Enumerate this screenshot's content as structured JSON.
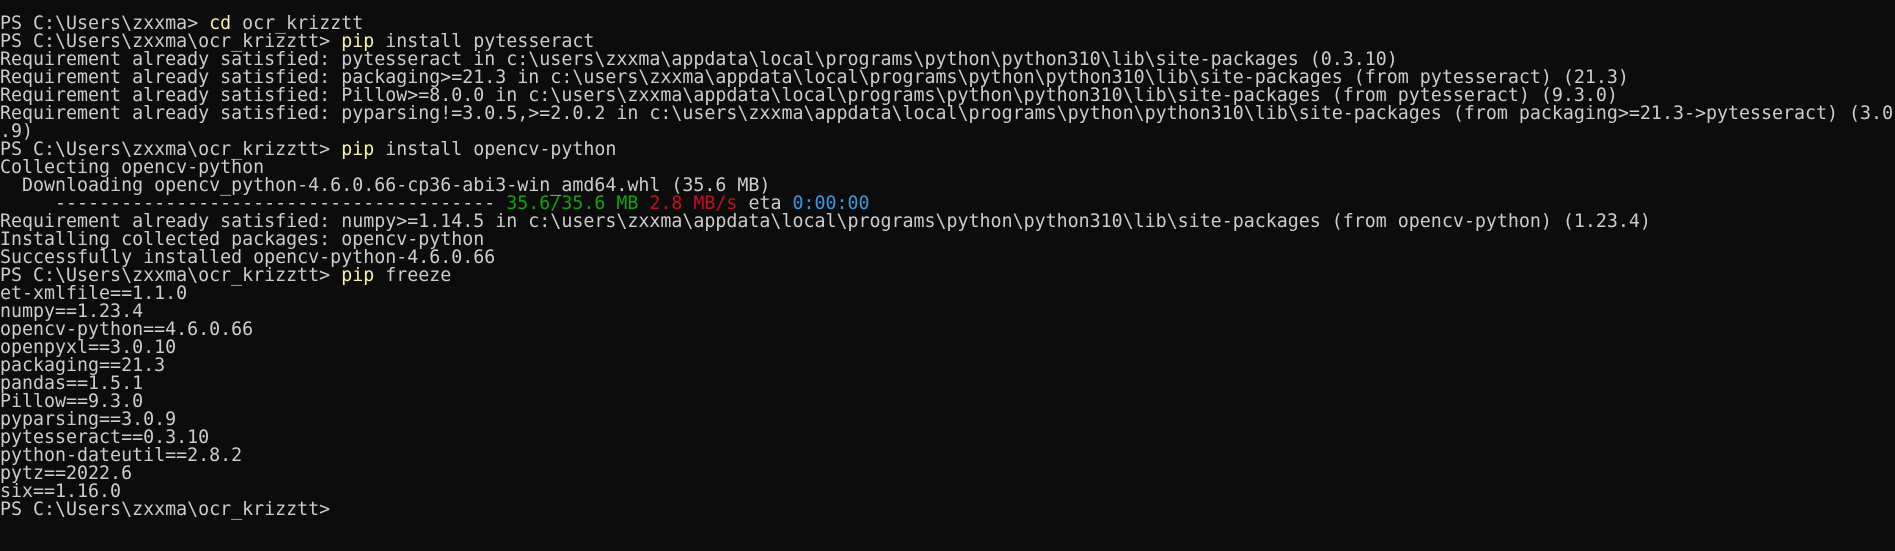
{
  "terminal": {
    "lines": [
      {
        "prompt": "PS C:\\Users\\zxxma> ",
        "cmd": "cd",
        "args": " ocr_krizztt"
      },
      {
        "prompt": "PS C:\\Users\\zxxma\\ocr_krizztt> ",
        "cmd": "pip",
        "args": " install pytesseract"
      },
      {
        "text": "Requirement already satisfied: pytesseract in c:\\users\\zxxma\\appdata\\local\\programs\\python\\python310\\lib\\site-packages (0.3.10)"
      },
      {
        "text": "Requirement already satisfied: packaging>=21.3 in c:\\users\\zxxma\\appdata\\local\\programs\\python\\python310\\lib\\site-packages (from pytesseract) (21.3)"
      },
      {
        "text": "Requirement already satisfied: Pillow>=8.0.0 in c:\\users\\zxxma\\appdata\\local\\programs\\python\\python310\\lib\\site-packages (from pytesseract) (9.3.0)"
      },
      {
        "text": "Requirement already satisfied: pyparsing!=3.0.5,>=2.0.2 in c:\\users\\zxxma\\appdata\\local\\programs\\python\\python310\\lib\\site-packages (from packaging>=21.3->pytesseract) (3.0"
      },
      {
        "text": ".9)"
      },
      {
        "prompt": "PS C:\\Users\\zxxma\\ocr_krizztt> ",
        "cmd": "pip",
        "args": " install opencv-python"
      },
      {
        "text": "Collecting opencv-python"
      },
      {
        "text": "  Downloading opencv_python-4.6.0.66-cp36-abi3-win_amd64.whl (35.6 MB)"
      },
      {
        "progress": {
          "bar": "     ----------------------------------------",
          "size": " 35.6/35.6 MB",
          "speed": " 2.8 MB/s",
          "eta_label": " eta",
          "eta_value": " 0:00:00"
        }
      },
      {
        "text": "Requirement already satisfied: numpy>=1.14.5 in c:\\users\\zxxma\\appdata\\local\\programs\\python\\python310\\lib\\site-packages (from opencv-python) (1.23.4)"
      },
      {
        "text": "Installing collected packages: opencv-python"
      },
      {
        "text": "Successfully installed opencv-python-4.6.0.66"
      },
      {
        "prompt": "PS C:\\Users\\zxxma\\ocr_krizztt> ",
        "cmd": "pip",
        "args": " freeze"
      },
      {
        "text": "et-xmlfile==1.1.0"
      },
      {
        "text": "numpy==1.23.4"
      },
      {
        "text": "opencv-python==4.6.0.66"
      },
      {
        "text": "openpyxl==3.0.10"
      },
      {
        "text": "packaging==21.3"
      },
      {
        "text": "pandas==1.5.1"
      },
      {
        "text": "Pillow==9.3.0"
      },
      {
        "text": "pyparsing==3.0.9"
      },
      {
        "text": "pytesseract==0.3.10"
      },
      {
        "text": "python-dateutil==2.8.2"
      },
      {
        "text": "pytz==2022.6"
      },
      {
        "text": "six==1.16.0"
      },
      {
        "prompt": "PS C:\\Users\\zxxma\\ocr_krizztt> "
      }
    ]
  },
  "colors": {
    "background": "#0c0c0c",
    "text": "#cccccc",
    "command": "#f9f1a5",
    "progress_size": "#13a10e",
    "progress_speed": "#c50f1f",
    "progress_eta": "#3a96dd"
  }
}
